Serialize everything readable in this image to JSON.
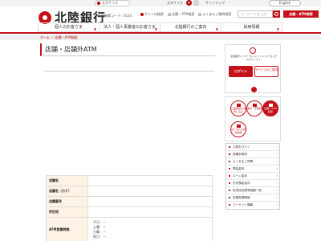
{
  "util": {
    "font_pill": "文字サイズ",
    "font_size_label": "文字サイズ",
    "size_medium": "中",
    "size_large": "大",
    "sitemap": "サイトマップ",
    "lang": "English"
  },
  "header": {
    "logo": "北陸銀行",
    "bank_code": "金融機関コード：0144",
    "search_opts": [
      "サイト内検索",
      "店舗・ATM検索",
      "よくあるご質問検索"
    ],
    "search_placeholder": "キーワードを入力",
    "atm_search": "店舗・ATM検索"
  },
  "nav": {
    "items": [
      "個人のお客さま",
      "法人・個人事業者のお客さま",
      "北陸銀行のご案内",
      "採用情報"
    ]
  },
  "breadcrumb": {
    "home": "ホーム",
    "sep": "＞",
    "section": "店舗・ATM検索"
  },
  "page": {
    "title": "店舗・店舗外ATM"
  },
  "table": {
    "rows": [
      {
        "label": "店舗名",
        "value": ""
      },
      {
        "label": "店舗名（カナ）",
        "value": ""
      },
      {
        "label": "店舗番号",
        "value": ""
      },
      {
        "label": "所在地",
        "value": ""
      }
    ],
    "hours_label": "ATM営業時間",
    "hours": [
      "平日：－",
      "土曜：－",
      "日曜：－",
      "祝日：－"
    ]
  },
  "sidebar": {
    "banner_text": "北陸銀行インターネットバンキング ほくぎんダイレクト",
    "login": "ログイン",
    "service": "サービスのご案内",
    "web_app": "Web通帳明細",
    "quick": [
      {
        "label": "口座開設のお申し込み"
      },
      {
        "label": "金利・手数料"
      },
      {
        "label": "店舗・ATM検索"
      },
      {
        "label": "ほくぎんの資産運用"
      }
    ],
    "menu": [
      "口座をひらく",
      "各種手数料",
      "よくあるご質問",
      "預金金利",
      "ローン金利",
      "外貨預金金利",
      "投資信託基準価額一覧",
      "為替相場情報",
      "マーケット情報"
    ]
  },
  "colors": {
    "accent": "#c4121a",
    "table_header": "#fdf2e3"
  }
}
